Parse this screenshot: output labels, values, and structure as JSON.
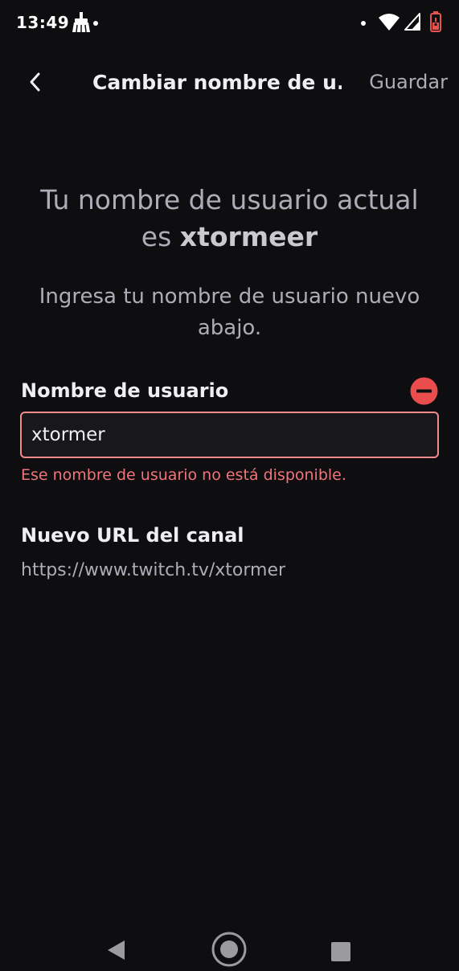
{
  "status_bar": {
    "time": "13:49",
    "icons": [
      "broom-icon",
      "notification-dot",
      "wifi-icon",
      "cell-signal-icon",
      "battery-icon"
    ]
  },
  "app_bar": {
    "title": "Cambiar nombre de u...",
    "save_label": "Guardar",
    "back_icon": "chevron-left-icon"
  },
  "intro": {
    "line1": "Tu nombre de usuario actual",
    "line2_prefix": "es ",
    "current_username": "xtormeer"
  },
  "instruction": "Ingresa tu nombre de usuario nuevo abajo.",
  "username_field": {
    "label": "Nombre de usuario",
    "value": "xtormer",
    "error_message": "Ese nombre de usuario no está disponible.",
    "error_icon": "minus-circle-icon"
  },
  "channel_url": {
    "label": "Nuevo URL del canal",
    "value": "https://www.twitch.tv/xtormer"
  },
  "colors": {
    "background": "#0e0e10",
    "text_primary": "#efeff1",
    "text_secondary": "#adadb8",
    "error": "#f0757a",
    "input_border_error": "#f28b8b",
    "error_icon": "#eb4d4d",
    "battery": "#e8534d"
  },
  "nav_bar": {
    "buttons": [
      "back-triangle-icon",
      "home-circle-icon",
      "recents-square-icon"
    ]
  }
}
